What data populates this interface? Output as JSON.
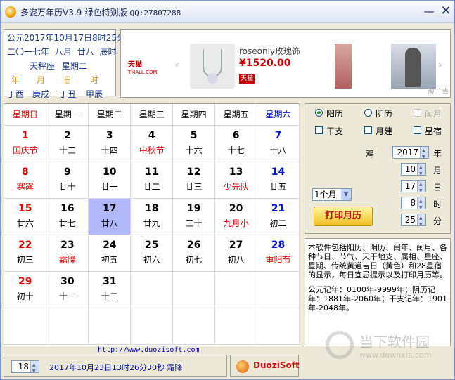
{
  "window": {
    "title": "多姿万年历V3.9-绿色特别版",
    "qq": "QQ:27807288",
    "minimize": "—",
    "close": "✕"
  },
  "info": {
    "gregorian": "公元2017年10月17日8时25分",
    "lunar": [
      "二〇一七年",
      "八月",
      "廿八",
      "辰时"
    ],
    "zodiac": "天秤座",
    "weekday": "星期二",
    "pillar_labels": [
      "年",
      "月",
      "日",
      "时"
    ],
    "pillars": [
      "丁酉",
      "庚戌",
      "丁丑",
      "甲辰"
    ]
  },
  "ad": {
    "brand": "天猫",
    "brand_sub": "TMALL.COM",
    "product_name": "roseonly玫瑰饰",
    "price": "¥1520.00",
    "badge": "天猫",
    "left_arrow": "‹",
    "right_arrow": "›",
    "label": "淘 广告"
  },
  "calendar": {
    "weekdays": [
      "星期日",
      "星期一",
      "星期二",
      "星期三",
      "星期四",
      "星期五",
      "星期六"
    ],
    "weeks": [
      [
        {
          "d": "1",
          "l": "国庆节",
          "c": "red",
          "lc": "red"
        },
        {
          "d": "2",
          "l": "十三"
        },
        {
          "d": "3",
          "l": "十四"
        },
        {
          "d": "4",
          "l": "中秋节",
          "lc": "red"
        },
        {
          "d": "5",
          "l": "十六"
        },
        {
          "d": "6",
          "l": "十七"
        },
        {
          "d": "7",
          "l": "十八",
          "c": "blue"
        }
      ],
      [
        {
          "d": "8",
          "l": "寒露",
          "c": "red",
          "lc": "red"
        },
        {
          "d": "9",
          "l": "廿十"
        },
        {
          "d": "10",
          "l": "廿一"
        },
        {
          "d": "11",
          "l": "廿二"
        },
        {
          "d": "12",
          "l": "廿三"
        },
        {
          "d": "13",
          "l": "少先队",
          "lc": "red"
        },
        {
          "d": "14",
          "l": "廿五",
          "c": "blue"
        }
      ],
      [
        {
          "d": "15",
          "l": "廿六",
          "c": "red"
        },
        {
          "d": "16",
          "l": "廿七"
        },
        {
          "d": "17",
          "l": "廿八",
          "sel": true
        },
        {
          "d": "18",
          "l": "廿九"
        },
        {
          "d": "19",
          "l": "三十"
        },
        {
          "d": "20",
          "l": "九月小",
          "lc": "red"
        },
        {
          "d": "21",
          "l": "初二",
          "c": "blue"
        }
      ],
      [
        {
          "d": "22",
          "l": "初三",
          "c": "red"
        },
        {
          "d": "23",
          "l": "霜降",
          "lc": "red"
        },
        {
          "d": "24",
          "l": "初五"
        },
        {
          "d": "25",
          "l": "初六"
        },
        {
          "d": "26",
          "l": "初七"
        },
        {
          "d": "27",
          "l": "初八"
        },
        {
          "d": "28",
          "l": "重阳节",
          "c": "blue",
          "lc": "red"
        }
      ],
      [
        {
          "d": "29",
          "l": "初十",
          "c": "red"
        },
        {
          "d": "30",
          "l": "十一"
        },
        {
          "d": "31",
          "l": "十二"
        },
        {
          "d": "",
          "l": ""
        },
        {
          "d": "",
          "l": ""
        },
        {
          "d": "",
          "l": ""
        },
        {
          "d": "",
          "l": ""
        }
      ],
      [
        {
          "d": "",
          "l": ""
        },
        {
          "d": "",
          "l": ""
        },
        {
          "d": "",
          "l": ""
        },
        {
          "d": "",
          "l": ""
        },
        {
          "d": "",
          "l": ""
        },
        {
          "d": "",
          "l": ""
        },
        {
          "d": "",
          "l": ""
        }
      ]
    ]
  },
  "controls": {
    "solar_label": "阳历",
    "lunar_label": "阴历",
    "leap_label": "闰月",
    "ganzhi_label": "干支",
    "monthjian_label": "月建",
    "star_label": "星宿",
    "zodiac_animal": "鸡",
    "year": "2017",
    "year_unit": "年",
    "month": "10",
    "month_unit": "月",
    "day": "17",
    "day_unit": "日",
    "hour": "8",
    "hour_unit": "时",
    "minute": "25",
    "minute_unit": "分",
    "range_select": "1个月",
    "print_button": "打印月历"
  },
  "description": {
    "p1": "本软件包括阳历、阴历、闰年、闰月、各种节日、节气、天干地支、属相、星座、星期、传统黄道吉日（黄色）和28星宿的显示，每日宜忌提示以及打印月历等。",
    "p2": "公元记年：0100年-9999年；阴历记年：1881年-2060年；干支记年：1901年-2048年。"
  },
  "footer": {
    "url": "http://www.duozisoft.com",
    "font_size": "18",
    "status": "2017年10月23日13时26分30秒 霜降",
    "logo": "DuoziSoft"
  },
  "watermark": {
    "text": "当下软件园",
    "url": "www.downxia.com"
  }
}
